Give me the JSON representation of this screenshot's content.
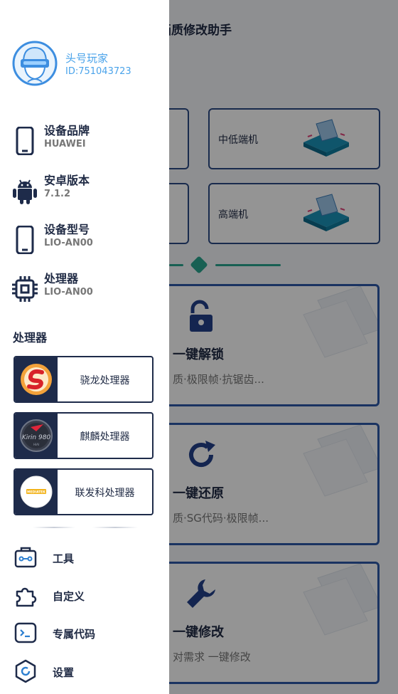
{
  "app": {
    "title_partial": "画质修改助手",
    "grade_cards": [
      {
        "label": "中低端机"
      },
      {
        "label": "高端机"
      }
    ],
    "actions": [
      {
        "title": "一键解锁",
        "subtitle": "质·极限帧·抗锯齿..."
      },
      {
        "title": "一键还原",
        "subtitle": "质·SG代码·极限帧..."
      },
      {
        "title": "一键修改",
        "subtitle": "对需求 一键修改"
      }
    ],
    "colors": {
      "card_border": "#2d58a8",
      "accent_green": "#2aa690"
    }
  },
  "drawer": {
    "user": {
      "name": "头号玩家",
      "id": "ID:751043723",
      "avatar_icon": "vr-player-avatar-icon"
    },
    "device_info": [
      {
        "key": "brand",
        "label": "设备品牌",
        "value": "HUAWEI",
        "icon": "phone-icon"
      },
      {
        "key": "android",
        "label": "安卓版本",
        "value": "7.1.2",
        "icon": "android-icon"
      },
      {
        "key": "model",
        "label": "设备型号",
        "value": "LIO-AN00",
        "icon": "phone-icon"
      },
      {
        "key": "cpu",
        "label": "处理器",
        "value": "LIO-AN00",
        "icon": "chip-icon"
      }
    ],
    "processor_section": {
      "title": "处理器",
      "options": [
        {
          "label": "骁龙处理器",
          "logo": "snapdragon-logo"
        },
        {
          "label": "麒麟处理器",
          "logo": "kirin-980-logo"
        },
        {
          "label": "联发科处理器",
          "logo": "mediatek-logo"
        }
      ]
    },
    "menu": [
      {
        "label": "工具",
        "icon": "toolbox-icon"
      },
      {
        "label": "自定义",
        "icon": "puzzle-icon"
      },
      {
        "label": "专属代码",
        "icon": "terminal-icon"
      },
      {
        "label": "设置",
        "icon": "settings-icon"
      }
    ],
    "colors": {
      "name_text": "#4aa3ea",
      "navy": "#1e2b4a"
    }
  }
}
